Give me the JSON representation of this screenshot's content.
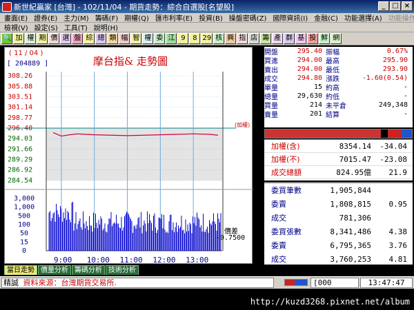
{
  "window": {
    "title": "新世紀贏家 [台灣] - 102/11/04 - 期貨走勢：綜合自選股[名望股]"
  },
  "menu1": [
    "畫面(E)",
    "證券(E)",
    "主力(M)",
    "籌碼(F)",
    "期權(Q)",
    "匯市利率(E)",
    "投資(B)",
    "操盤密碼(Z)",
    "國際資訊(I)",
    "金融(C)",
    "功能選擇(A)",
    "功能操作"
  ],
  "menu2": [
    "檢視(V)",
    "設定(S)",
    "工具(T)",
    "說明(H)"
  ],
  "toolbar": [
    "加",
    "權",
    "期",
    "價",
    "選",
    "盤",
    "綜",
    "總",
    "類",
    "幅",
    "智",
    "權",
    "委",
    "江",
    "9",
    "8",
    "29",
    "核",
    "興",
    "指",
    "店",
    "籌",
    "產",
    "群",
    "基",
    "投",
    "鮮",
    "網"
  ],
  "chart": {
    "date_label": "( 11 / 04 )",
    "code_label": "[ 204889 ]",
    "title": "摩台指&  走勢圖",
    "ref_label": "(加權)",
    "diff_label": "價差",
    "diff_value": "-0.7500",
    "price_ticks": [
      "308.26",
      "305.88",
      "303.51",
      "301.14",
      "298.77",
      "296.40",
      "294.03",
      "291.66",
      "289.29",
      "286.92",
      "284.54"
    ],
    "volume_ticks": [
      "3,000",
      "1,000",
      "500",
      "100",
      "50",
      "15",
      "0"
    ],
    "time_ticks": [
      "9:00",
      "10:00",
      "11:00",
      "12:00",
      "13:00"
    ]
  },
  "chart_data": {
    "type": "line",
    "title": "摩台指&  走勢圖",
    "xlabel": "",
    "ylabel": "",
    "ylim": [
      284.54,
      308.26
    ],
    "x": [
      "08:45",
      "09:00",
      "09:15",
      "09:30",
      "09:45",
      "10:00",
      "10:30",
      "11:00",
      "11:30",
      "12:00",
      "12:30",
      "13:00",
      "13:30",
      "13:45"
    ],
    "series": [
      {
        "name": "",
        "values": [
          295.4,
          294.6,
          294.9,
          295.1,
          295.0,
          294.9,
          294.8,
          294.7,
          294.8,
          294.9,
          295.0,
          295.1,
          295.0,
          294.8
        ]
      }
    ],
    "reference": 296.4,
    "grid": true
  },
  "quotes": [
    {
      "l1": "開盤",
      "v1": "295.40",
      "l2": "振幅",
      "v2": "0.67%"
    },
    {
      "l1": "買進",
      "v1": "294.00",
      "l2": "最高",
      "v2": "295.90"
    },
    {
      "l1": "賣出",
      "v1": "294.00",
      "l2": "最低",
      "v2": "293.90"
    },
    {
      "l1": "成交",
      "v1": "294.80",
      "l2": "漲跌",
      "v2": "-1.60(0.54)"
    },
    {
      "l1": "單量",
      "v1": "15",
      "l2": "約高",
      "v2": "-"
    },
    {
      "l1": "總量",
      "v1": "29,630",
      "l2": "約低",
      "v2": "-"
    },
    {
      "l1": "買量",
      "v1": "214",
      "l2": "未平倉",
      "v2": "249,348"
    },
    {
      "l1": "賣量",
      "v1": "201",
      "l2": "結算",
      "v2": "-"
    }
  ],
  "index_rows": [
    {
      "label": "加權(含)",
      "value": "8354.14",
      "change": "-34.04"
    },
    {
      "label": "加權(不)",
      "value": "7015.47",
      "change": "-23.08"
    },
    {
      "label": "成交總額",
      "value": "824.95億",
      "change": "21.9"
    }
  ],
  "stat_rows": [
    {
      "label": "委買筆數",
      "value": "1,905,844",
      "change": ""
    },
    {
      "label": "委賣",
      "value": "1,808,815",
      "change": "0.95"
    },
    {
      "label": "成交",
      "value": "781,306",
      "change": ""
    },
    {
      "label": "委買張數",
      "value": "8,341,486",
      "change": "4.38"
    },
    {
      "label": "委賣",
      "value": "6,795,365",
      "change": "3.76"
    },
    {
      "label": "成交",
      "value": "3,760,253",
      "change": "4.81"
    }
  ],
  "tabs": [
    "當日走勢",
    "價量分析",
    "籌碼分析",
    "技術分析"
  ],
  "status": {
    "lead": "精誠",
    "message": "資料來源：台灣期貨交易所.",
    "count": "[000",
    "time": "13:47:47"
  },
  "watermark": "http://kuzd3268.pixnet.net/album",
  "colors": {
    "price_line": "#cc0033",
    "volume_bar": "#0000cc",
    "grid": "#6fa8dc"
  }
}
